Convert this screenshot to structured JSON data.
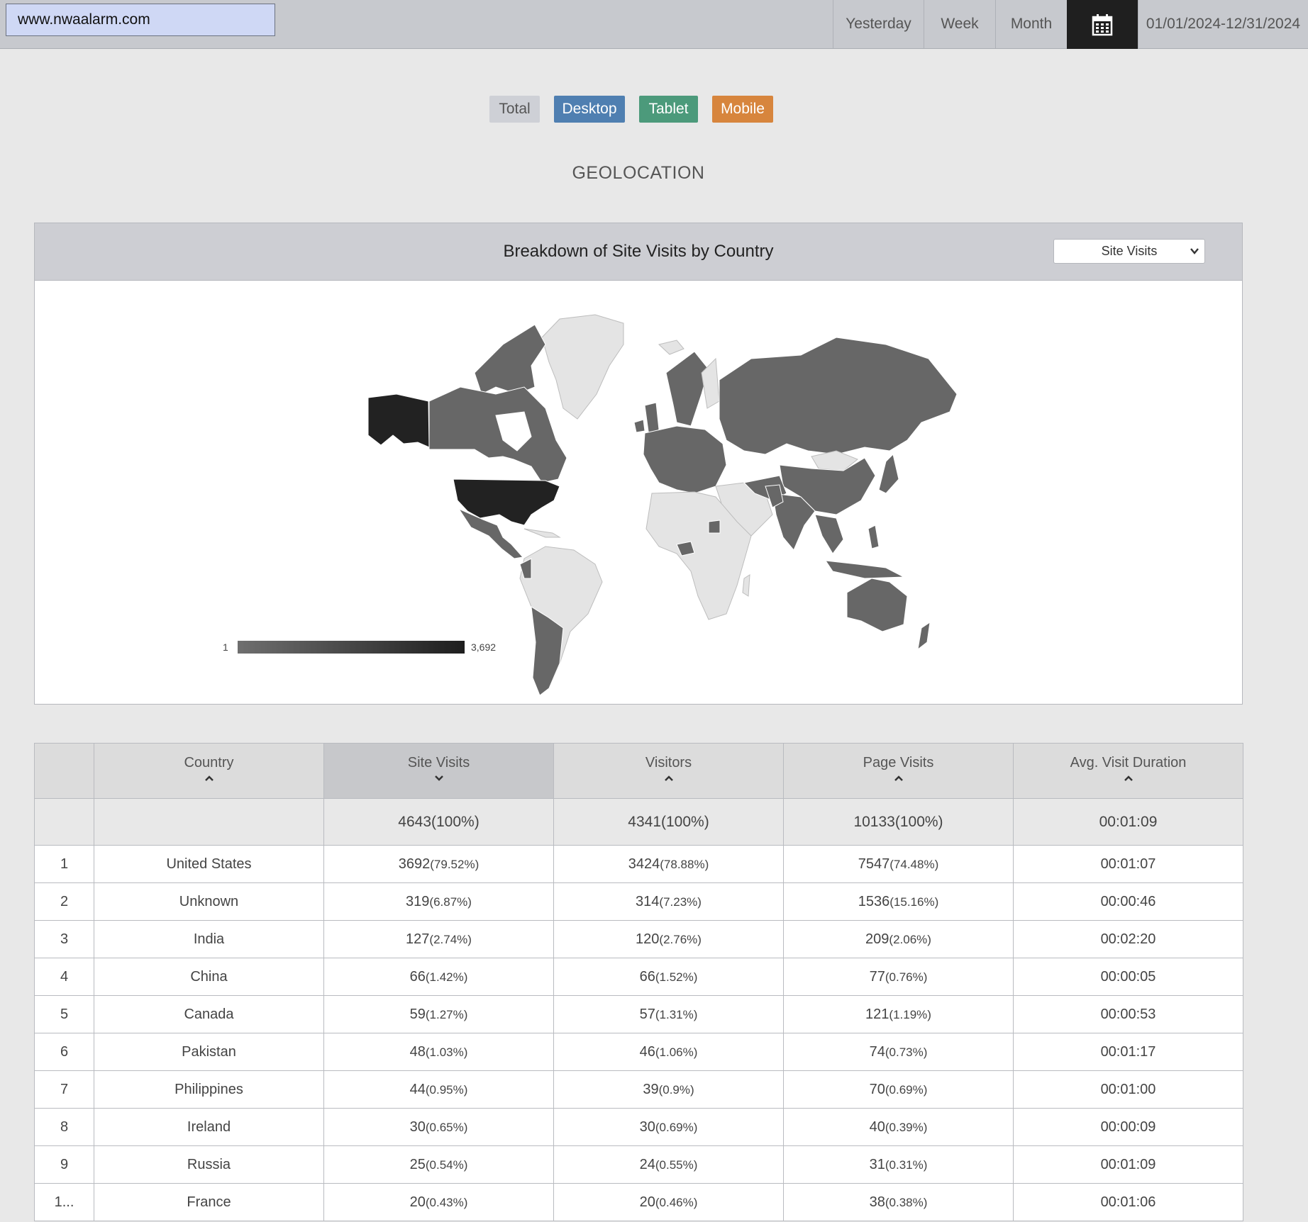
{
  "site_input": {
    "value": "www.nwaalarm.com"
  },
  "date_range": {
    "options": [
      "Yesterday",
      "Week",
      "Month"
    ],
    "calendar_icon": "calendar-icon",
    "current": "01/01/2024-12/31/2024"
  },
  "device_filter": {
    "total": "Total",
    "desktop": "Desktop",
    "tablet": "Tablet",
    "mobile": "Mobile",
    "colors": {
      "total": "#ced0d6",
      "desktop": "#4f7fb1",
      "tablet": "#4c9a7b",
      "mobile": "#d7853d"
    }
  },
  "section_title": "GEOLOCATION",
  "map_panel": {
    "title": "Breakdown of Site Visits by Country",
    "metric_select": "Site Visits",
    "legend_min": "1",
    "legend_max": "3,692",
    "legend_colors": {
      "low": "#6f6f6f",
      "high": "#1e1e1e"
    }
  },
  "table": {
    "columns": [
      "Country",
      "Site Visits",
      "Visitors",
      "Page Visits",
      "Avg. Visit Duration"
    ],
    "sorted_column": "Site Visits",
    "totals": {
      "site_visits": "4643(100%)",
      "visitors": "4341(100%)",
      "page_visits": "10133(100%)",
      "avg_duration": "00:01:09"
    },
    "rows": [
      {
        "rank": "1",
        "country": "United States",
        "sv": "3692",
        "sv_pct": "(79.52%)",
        "vi": "3424",
        "vi_pct": "(78.88%)",
        "pv": "7547",
        "pv_pct": "(74.48%)",
        "dur": "00:01:07"
      },
      {
        "rank": "2",
        "country": "Unknown",
        "sv": "319",
        "sv_pct": "(6.87%)",
        "vi": "314",
        "vi_pct": "(7.23%)",
        "pv": "1536",
        "pv_pct": "(15.16%)",
        "dur": "00:00:46"
      },
      {
        "rank": "3",
        "country": "India",
        "sv": "127",
        "sv_pct": "(2.74%)",
        "vi": "120",
        "vi_pct": "(2.76%)",
        "pv": "209",
        "pv_pct": "(2.06%)",
        "dur": "00:02:20"
      },
      {
        "rank": "4",
        "country": "China",
        "sv": "66",
        "sv_pct": "(1.42%)",
        "vi": "66",
        "vi_pct": "(1.52%)",
        "pv": "77",
        "pv_pct": "(0.76%)",
        "dur": "00:00:05"
      },
      {
        "rank": "5",
        "country": "Canada",
        "sv": "59",
        "sv_pct": "(1.27%)",
        "vi": "57",
        "vi_pct": "(1.31%)",
        "pv": "121",
        "pv_pct": "(1.19%)",
        "dur": "00:00:53"
      },
      {
        "rank": "6",
        "country": "Pakistan",
        "sv": "48",
        "sv_pct": "(1.03%)",
        "vi": "46",
        "vi_pct": "(1.06%)",
        "pv": "74",
        "pv_pct": "(0.73%)",
        "dur": "00:01:17"
      },
      {
        "rank": "7",
        "country": "Philippines",
        "sv": "44",
        "sv_pct": "(0.95%)",
        "vi": "39",
        "vi_pct": "(0.9%)",
        "pv": "70",
        "pv_pct": "(0.69%)",
        "dur": "00:01:00"
      },
      {
        "rank": "8",
        "country": "Ireland",
        "sv": "30",
        "sv_pct": "(0.65%)",
        "vi": "30",
        "vi_pct": "(0.69%)",
        "pv": "40",
        "pv_pct": "(0.39%)",
        "dur": "00:00:09"
      },
      {
        "rank": "9",
        "country": "Russia",
        "sv": "25",
        "sv_pct": "(0.54%)",
        "vi": "24",
        "vi_pct": "(0.55%)",
        "pv": "31",
        "pv_pct": "(0.31%)",
        "dur": "00:01:09"
      },
      {
        "rank": "1...",
        "country": "France",
        "sv": "20",
        "sv_pct": "(0.43%)",
        "vi": "20",
        "vi_pct": "(0.46%)",
        "pv": "38",
        "pv_pct": "(0.38%)",
        "dur": "00:01:06"
      }
    ]
  }
}
